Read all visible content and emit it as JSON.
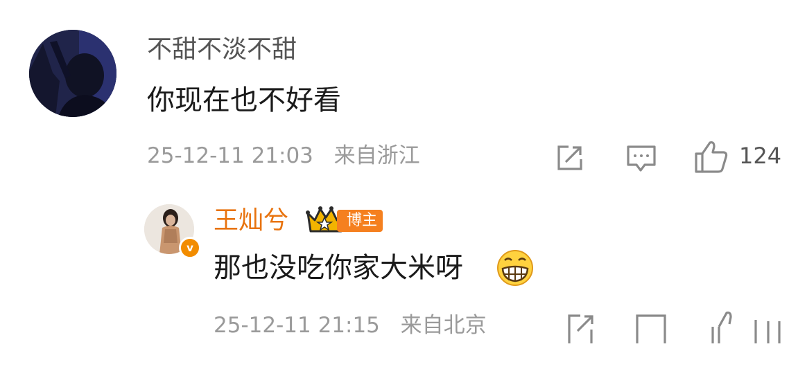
{
  "comment": {
    "username": "不甜不淡不甜",
    "text": "你现在也不好看",
    "timestamp": "25-12-11 21:03",
    "location": "来自浙江",
    "like_count": "124",
    "actions": [
      "share-icon",
      "comment-icon",
      "like-icon"
    ]
  },
  "reply": {
    "username": "王灿兮",
    "badge": "博主",
    "text": "那也没吃你家大米呀",
    "emoji": "grin-emoji",
    "timestamp": "25-12-11 21:15",
    "location": "来自北京",
    "verified_icon": "v",
    "actions": [
      "share-icon",
      "comment-icon",
      "like-icon"
    ]
  },
  "colors": {
    "username_gray": "#555555",
    "meta_gray": "#9a9a9a",
    "blogger_orange": "#e8730e",
    "badge_orange": "#f5801f",
    "crown_gold": "#f2b400"
  }
}
